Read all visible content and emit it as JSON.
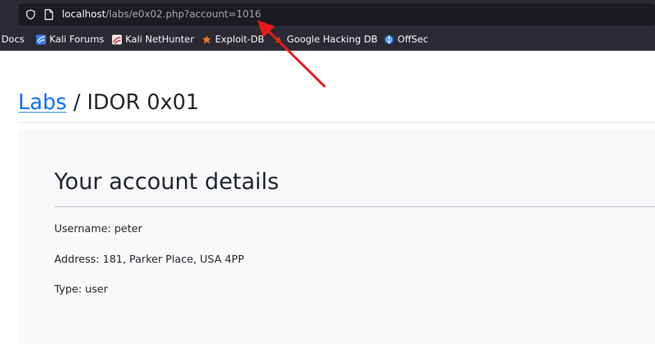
{
  "browser": {
    "url_host": "localhost",
    "url_path": "/labs/e0x02.php?account=1016"
  },
  "bookmarks": [
    {
      "label": "i Docs",
      "icon": "kali-docs-icon"
    },
    {
      "label": "Kali Forums",
      "icon": "kali-forums-icon"
    },
    {
      "label": "Kali NetHunter",
      "icon": "kali-nethunter-icon"
    },
    {
      "label": "Exploit-DB",
      "icon": "exploit-db-icon"
    },
    {
      "label": "Google Hacking DB",
      "icon": "ghdb-icon"
    },
    {
      "label": "OffSec",
      "icon": "offsec-icon"
    }
  ],
  "page": {
    "breadcrumb_link": "Labs",
    "breadcrumb_rest": " / IDOR 0x01"
  },
  "card": {
    "title": "Your account details",
    "username": "Username: peter",
    "address": "Address: 181, Parker Place, USA 4PP",
    "type": "Type: user"
  },
  "colors": {
    "annotation_arrow": "#e8191c",
    "link": "#0d6efd"
  }
}
